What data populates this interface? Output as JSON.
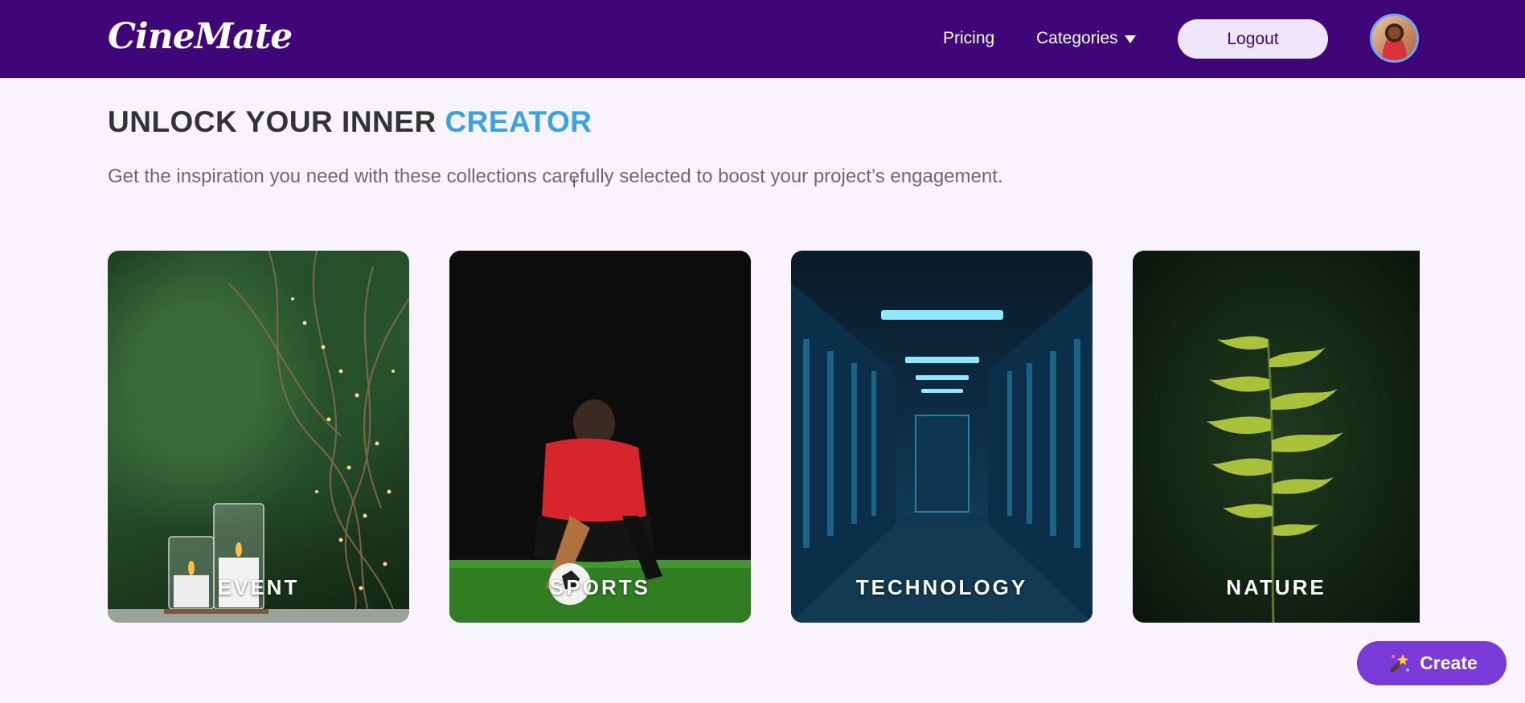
{
  "brand": {
    "name": "CineMate"
  },
  "nav": {
    "pricing": "Pricing",
    "categories": "Categories",
    "logout": "Logout"
  },
  "hero": {
    "heading_prefix": "UNLOCK YOUR INNER ",
    "heading_accent": "CREATOR",
    "subtitle": "Get the inspiration you need with these collections carefully selected to boost your project’s engagement."
  },
  "collections": [
    {
      "label": "EVENT",
      "icon": "event-image"
    },
    {
      "label": "SPORTS",
      "icon": "sports-image"
    },
    {
      "label": "TECHNOLOGY",
      "icon": "technology-image"
    },
    {
      "label": "NATURE",
      "icon": "nature-image"
    }
  ],
  "create_button": {
    "label": "Create",
    "icon": "magic-wand-icon"
  },
  "colors": {
    "navbar": "#3f0579",
    "accent": "#3aa3e3",
    "create_button": "#7a3ad9",
    "background": "#f9f3fe"
  }
}
